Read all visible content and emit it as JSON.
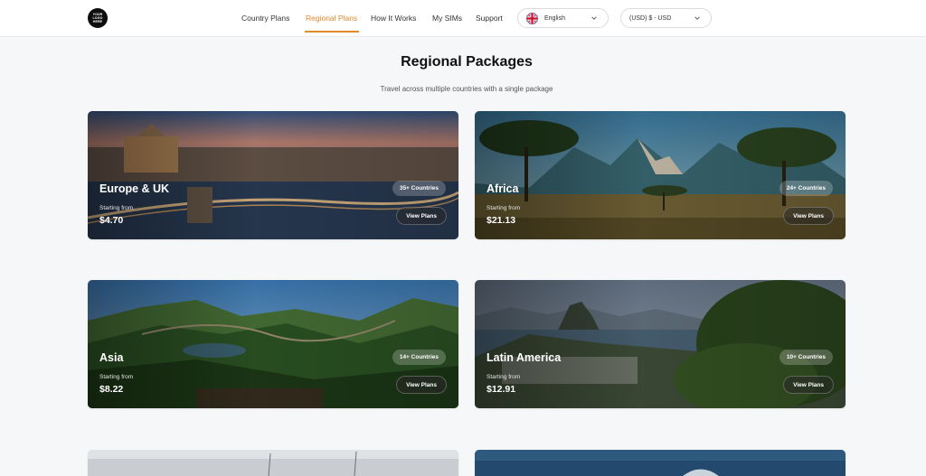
{
  "header": {
    "logo_lines": [
      "YOUR",
      "LOGO",
      "HERE"
    ],
    "nav": [
      "Country Plans",
      "Regional Plans",
      "How It Works",
      "My SIMs",
      "Support"
    ],
    "active_nav": "Regional Plans",
    "language": "English",
    "currency": "(USD) $ - USD"
  },
  "main": {
    "title": "Regional Packages",
    "subtitle": "Travel across multiple countries with a single package"
  },
  "cards": [
    {
      "name": "Europe & UK",
      "from": "Starting from",
      "price": "$4.70",
      "badge": "35+ Countries",
      "button": "View Plans"
    },
    {
      "name": "Africa",
      "from": "Starting from",
      "price": "$21.13",
      "badge": "24+ Countries",
      "button": "View Plans"
    },
    {
      "name": "Asia",
      "from": "Starting from",
      "price": "$8.22",
      "badge": "14+ Countries",
      "button": "View Plans"
    },
    {
      "name": "Latin America",
      "from": "Starting from",
      "price": "$12.91",
      "badge": "10+ Countries",
      "button": "View Plans"
    }
  ],
  "colors": {
    "accent": "#e08a2b",
    "background": "#f6f7f9"
  }
}
